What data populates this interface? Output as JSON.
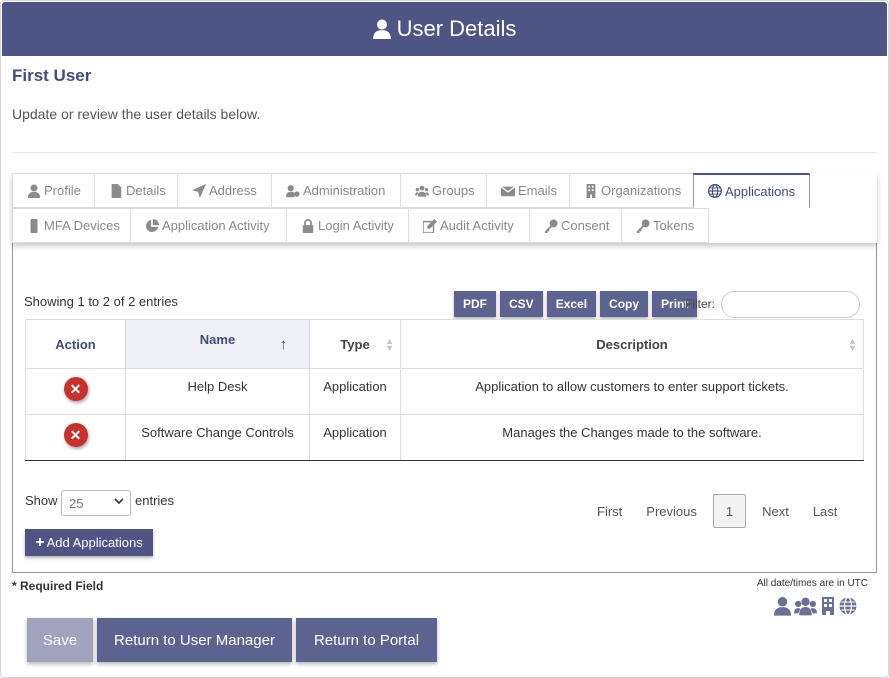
{
  "header": {
    "title": "User Details"
  },
  "user": {
    "name": "First User",
    "subtitle": "Update or review the user details below."
  },
  "tabs_row1": [
    {
      "label": "Profile",
      "icon": "user-icon"
    },
    {
      "label": "Details",
      "icon": "file-icon"
    },
    {
      "label": "Address",
      "icon": "location-arrow-icon"
    },
    {
      "label": "Administration",
      "icon": "user-gear-icon"
    },
    {
      "label": "Groups",
      "icon": "users-icon"
    },
    {
      "label": "Emails",
      "icon": "envelope-icon"
    },
    {
      "label": "Organizations",
      "icon": "building-icon"
    },
    {
      "label": "Applications",
      "icon": "globe-icon",
      "active": true
    }
  ],
  "tabs_row2": [
    {
      "label": "MFA Devices",
      "icon": "mobile-icon"
    },
    {
      "label": "Application Activity",
      "icon": "pie-chart-icon"
    },
    {
      "label": "Login Activity",
      "icon": "lock-icon"
    },
    {
      "label": "Audit Activity",
      "icon": "edit-icon"
    },
    {
      "label": "Consent",
      "icon": "key-icon"
    },
    {
      "label": "Tokens",
      "icon": "key-icon"
    }
  ],
  "table": {
    "info": "Showing 1 to 2 of 2 entries",
    "export_buttons": [
      "PDF",
      "CSV",
      "Excel",
      "Copy",
      "Print"
    ],
    "filter_label": "Filter:",
    "filter_value": "",
    "columns": [
      "Action",
      "Name",
      "Type",
      "Description"
    ],
    "sort_indicator": "↑",
    "rows": [
      {
        "name": "Help Desk",
        "type": "Application",
        "description": "Application to allow customers to enter support tickets."
      },
      {
        "name": "Software Change Controls",
        "type": "Application",
        "description": "Manages the Changes made to the software."
      }
    ],
    "show_label": "Show",
    "page_size": "25",
    "entries_label": "entries",
    "pager": {
      "first": "First",
      "previous": "Previous",
      "current": "1",
      "next": "Next",
      "last": "Last"
    },
    "add_button": "Add Applications"
  },
  "footer": {
    "required": "* Required Field",
    "utc_note": "All date/times are in UTC",
    "legend_icons": [
      "user-icon",
      "users-icon",
      "building-icon",
      "globe-icon"
    ]
  },
  "actions": {
    "save": "Save",
    "return_user_manager": "Return to User Manager",
    "return_portal": "Return to Portal"
  },
  "colors": {
    "header_bg": "#4e5584",
    "button_bg": "#5d6390",
    "save_disabled": "#a1a3bd",
    "delete_red": "#c9302c"
  }
}
